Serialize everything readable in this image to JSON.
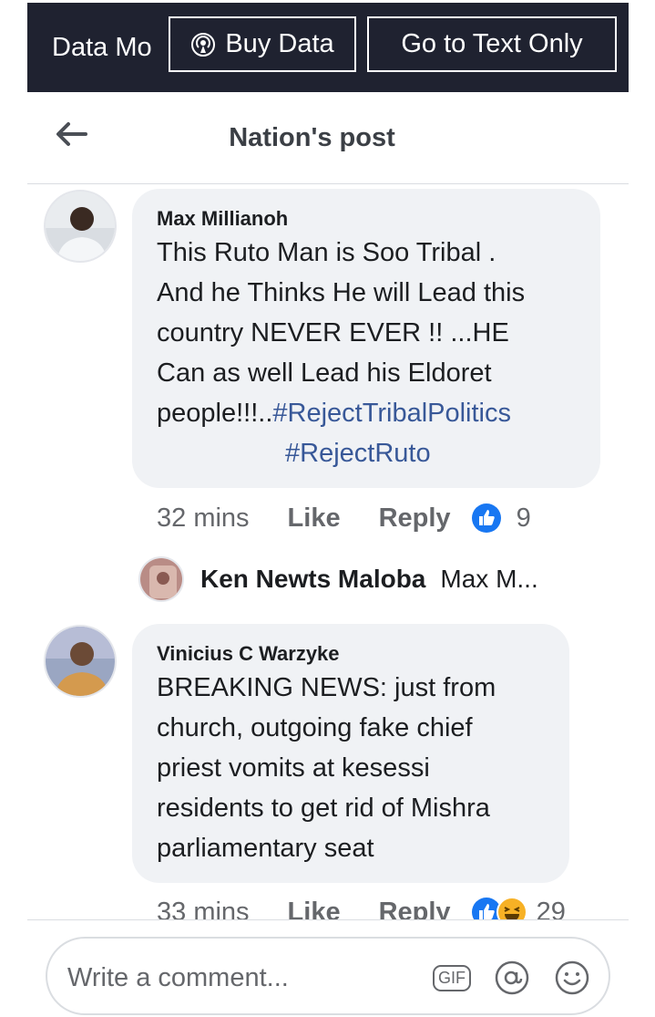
{
  "topbar": {
    "data_mode_label": "Data Mo",
    "buy_data_label": "Buy Data",
    "text_only_label": "Go to Text Only"
  },
  "header": {
    "title": "Nation's post"
  },
  "comments": [
    {
      "author": "Max Millianoh",
      "text_lines": [
        "This Ruto Man is Soo Tribal .",
        "And he Thinks He will Lead this",
        "country NEVER EVER !! ...HE",
        "Can as well Lead his Eldoret"
      ],
      "text_tail": "people!!!..",
      "hashtag1": "#RejectTribalPolitics",
      "hashtag2": "#RejectRuto",
      "time": "32 mins",
      "like_label": "Like",
      "reply_label": "Reply",
      "reaction_count": "9",
      "reaction_icons": [
        "like-reaction-icon"
      ]
    },
    {
      "author": "Vinicius C Warzyke",
      "text_lines": [
        "BREAKING NEWS: just from",
        "church, outgoing fake chief",
        "priest vomits at kesessi",
        "residents to get rid of Mishra",
        "parliamentary seat"
      ],
      "time": "33 mins",
      "like_label": "Like",
      "reply_label": "Reply",
      "reaction_count": "29",
      "reaction_icons": [
        "like-reaction-icon",
        "haha-reaction-icon"
      ]
    }
  ],
  "reply_preview": {
    "name": "Ken Newts Maloba",
    "snippet": "Max M..."
  },
  "composer": {
    "placeholder": "Write a comment...",
    "gif_label": "GIF"
  },
  "colors": {
    "topbar_bg": "#1f2230",
    "bubble_bg": "#f0f2f5",
    "hashtag": "#385898",
    "like_blue": "#1877f2",
    "meta_gray": "#65676b"
  }
}
